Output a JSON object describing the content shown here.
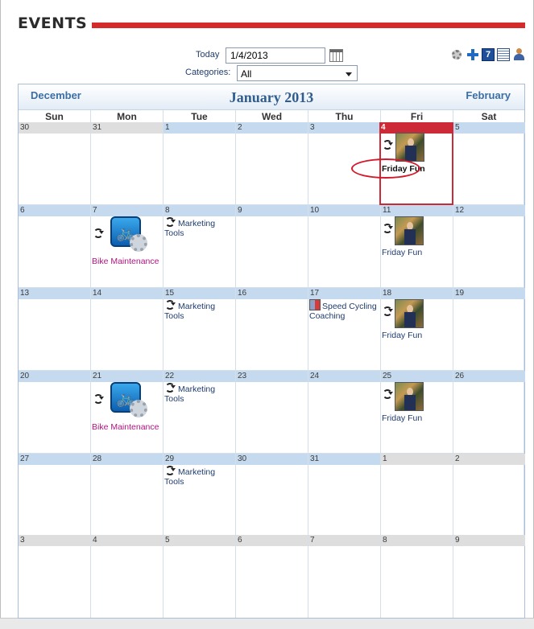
{
  "header": {
    "title": "EVENTS"
  },
  "filters": {
    "today_label": "Today",
    "today_value": "1/4/2013",
    "categories_label": "Categories:",
    "categories_value": "All"
  },
  "toolbar": {
    "settings_icon": "gear-icon",
    "add_icon": "plus-icon",
    "week_icon": "calendar-week-icon",
    "list_icon": "list-view-icon",
    "user_icon": "user-icon"
  },
  "calendar": {
    "prev_month": "December",
    "next_month": "February",
    "month_title": "January 2013",
    "weekdays": [
      "Sun",
      "Mon",
      "Tue",
      "Wed",
      "Thu",
      "Fri",
      "Sat"
    ],
    "days": [
      "30",
      "31",
      "1",
      "2",
      "3",
      "4",
      "5",
      "6",
      "7",
      "8",
      "9",
      "10",
      "11",
      "12",
      "13",
      "14",
      "15",
      "16",
      "17",
      "18",
      "19",
      "20",
      "21",
      "22",
      "23",
      "24",
      "25",
      "26",
      "27",
      "28",
      "29",
      "30",
      "31",
      "1",
      "2",
      "3",
      "4",
      "5",
      "6",
      "7",
      "8",
      "9"
    ],
    "events": {
      "friday_fun": "Friday Fun",
      "bike_maintenance": "Bike Maintenance",
      "marketing_tools": "Marketing Tools",
      "speed_cycling": "Speed Cycling Coaching"
    }
  },
  "colors": {
    "accent_red": "#d42a2a",
    "today_red": "#cc2a36",
    "day_header_blue": "#c5daef",
    "maintenance_magenta": "#b0147f"
  }
}
